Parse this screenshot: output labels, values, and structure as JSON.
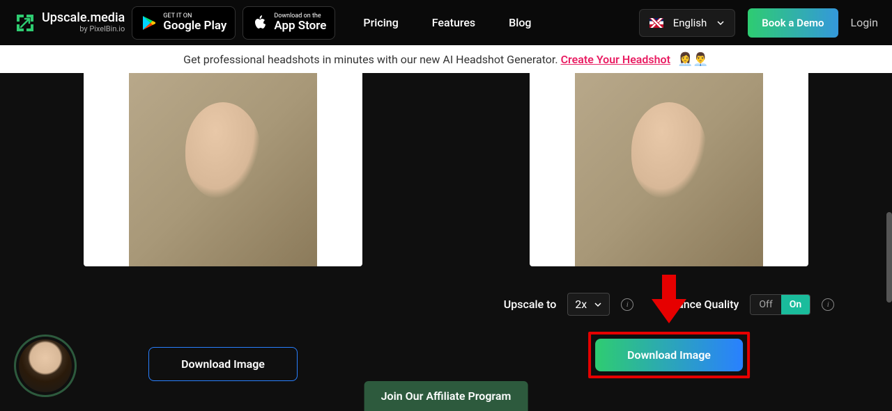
{
  "header": {
    "logo_main": "Upscale.media",
    "logo_sub": "by PixelBin.io",
    "google_play_small": "GET IT ON",
    "google_play_big": "Google Play",
    "app_store_small": "Download on the",
    "app_store_big": "App Store",
    "nav": {
      "pricing": "Pricing",
      "features": "Features",
      "blog": "Blog"
    },
    "language": "English",
    "demo": "Book a Demo",
    "login": "Login"
  },
  "banner": {
    "text": "Get professional headshots in minutes with our new AI Headshot Generator. ",
    "cta": "Create Your Headshot",
    "emoji": "👩‍💼👨‍💼"
  },
  "controls": {
    "upscale_label": "Upscale to",
    "upscale_value": "2x",
    "enhance_label": "Enhance Quality",
    "toggle_off": "Off",
    "toggle_on": "On"
  },
  "buttons": {
    "download_left": "Download Image",
    "download_right": "Download Image"
  },
  "affiliate": "Join Our Affiliate Program"
}
